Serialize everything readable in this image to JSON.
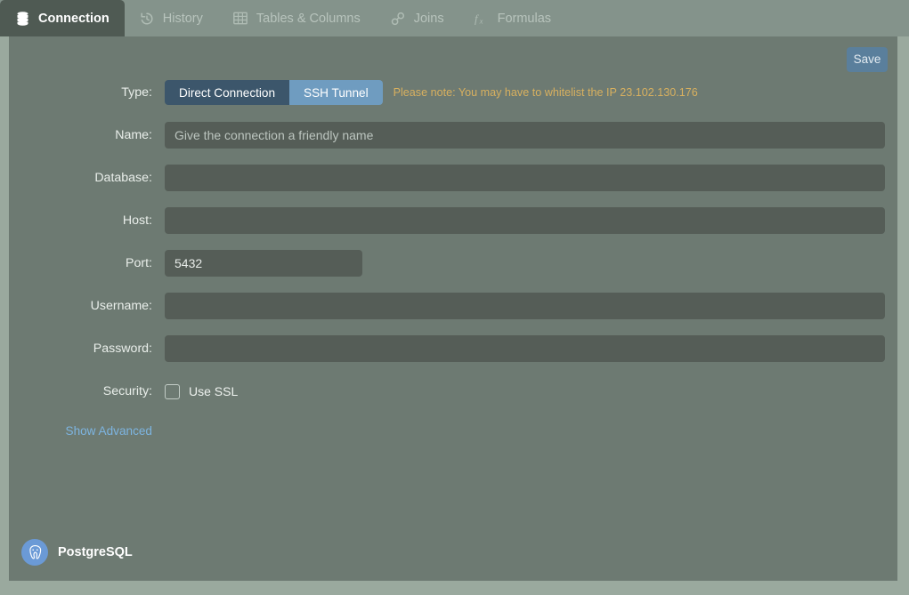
{
  "window": {
    "title": "Connection",
    "colors": {
      "page_background": "#9aa99e",
      "tabbar_background": "#84938b",
      "panel_background": "#6d7a72",
      "input_background": "#555d57",
      "active_tab_background": "#4f5a53",
      "accent_blue": "#5a7f9c",
      "segment_active": "#6f9cc0",
      "segment_inactive": "#3c566b",
      "note_text": "#d8b05f",
      "link_text": "#7db4e0",
      "brand_logo": "#6b9ad6"
    }
  },
  "tabs": [
    {
      "label": "Connection",
      "icon": "database-icon",
      "active": true
    },
    {
      "label": "History",
      "icon": "history-clock-icon",
      "active": false
    },
    {
      "label": "Tables & Columns",
      "icon": "table-grid-icon",
      "active": false
    },
    {
      "label": "Joins",
      "icon": "link-chain-icon",
      "active": false
    },
    {
      "label": "Formulas",
      "icon": "fx-formula-icon",
      "active": false
    }
  ],
  "toolbar": {
    "save_label": "Save"
  },
  "form": {
    "type": {
      "label": "Type:",
      "options": [
        {
          "label": "Direct Connection",
          "selected": false
        },
        {
          "label": "SSH Tunnel",
          "selected": true
        }
      ],
      "note": "Please note: You may have to whitelist the IP 23.102.130.176"
    },
    "name": {
      "label": "Name:",
      "value": "",
      "placeholder": "Give the connection a friendly name"
    },
    "database": {
      "label": "Database:",
      "value": "",
      "placeholder": ""
    },
    "host": {
      "label": "Host:",
      "value": "",
      "placeholder": ""
    },
    "port": {
      "label": "Port:",
      "value": "5432",
      "placeholder": ""
    },
    "username": {
      "label": "Username:",
      "value": "",
      "placeholder": ""
    },
    "password": {
      "label": "Password:",
      "value": "",
      "placeholder": ""
    },
    "security": {
      "label": "Security:",
      "checkbox_label": "Use SSL",
      "checked": false
    },
    "advanced_link": "Show Advanced"
  },
  "footer": {
    "brand_name": "PostgreSQL",
    "brand_icon": "postgresql-elephant-icon"
  }
}
